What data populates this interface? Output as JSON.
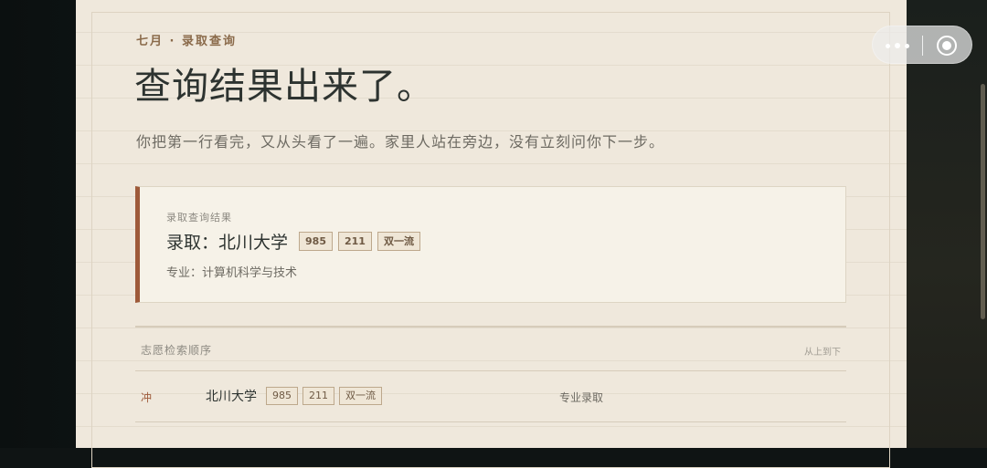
{
  "header": {
    "kicker": "七月 · 录取查询",
    "title": "查询结果出来了。",
    "lede": "你把第一行看完，又从头看了一遍。家里人站在旁边，没有立刻问你下一步。"
  },
  "result": {
    "label": "录取查询结果",
    "admitted": "录取：北川大学",
    "tags": [
      "985",
      "211",
      "双一流"
    ],
    "major": "专业：计算机科学与技术"
  },
  "order": {
    "heading": "志愿检索顺序",
    "direction": "从上到下",
    "rows": [
      {
        "rank": "冲",
        "school": "北川大学",
        "tags": [
          "985",
          "211",
          "双一流"
        ],
        "status": "专业录取"
      }
    ]
  },
  "capsule": {
    "more_icon": "more-dots-icon",
    "close_icon": "target-circle-icon"
  },
  "colors": {
    "accent": "#9e5a3a",
    "paper": "#efe8dc",
    "ink": "#2d3330"
  }
}
